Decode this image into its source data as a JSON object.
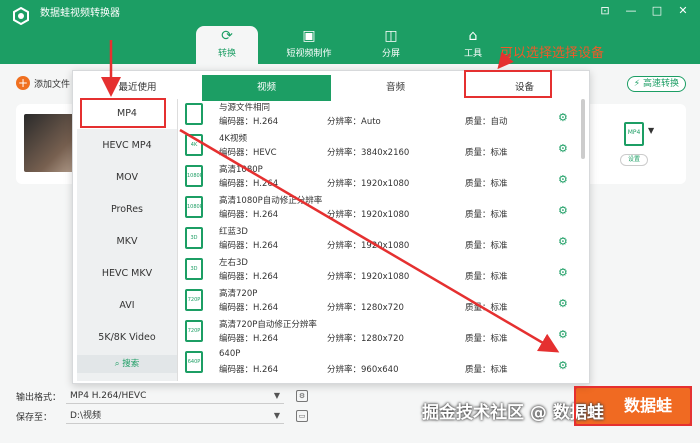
{
  "app": {
    "title": "数据蛙视频转换器",
    "window_controls": [
      "⊡",
      "—",
      "□",
      "✕"
    ]
  },
  "nav": {
    "tabs": [
      {
        "label": "转换",
        "icon": "convert-icon",
        "active": true
      },
      {
        "label": "短视频制作",
        "icon": "image-icon"
      },
      {
        "label": "分屏",
        "icon": "split-screen-icon"
      },
      {
        "label": "工具",
        "icon": "toolbox-icon"
      }
    ]
  },
  "toolbar": {
    "add_file": "添加文件",
    "fast_convert": "高速转换"
  },
  "popup": {
    "tabs": [
      {
        "label": "最近使用"
      },
      {
        "label": "视频",
        "active": true
      },
      {
        "label": "音频"
      },
      {
        "label": "设备"
      }
    ],
    "formats": [
      "MP4",
      "HEVC MP4",
      "MOV",
      "ProRes",
      "MKV",
      "HEVC MKV",
      "AVI",
      "5K/8K Video"
    ],
    "selected_format": "MP4",
    "search_label": "搜索",
    "presets": [
      {
        "name": "与源文件相同",
        "icon_text": "",
        "encoder": "编码器：H.264",
        "resolution": "分辨率：Auto",
        "quality": "质量：自动"
      },
      {
        "name": "4K视频",
        "icon_text": "4K",
        "encoder": "编码器：HEVC",
        "resolution": "分辨率：3840x2160",
        "quality": "质量：标准"
      },
      {
        "name": "高清1080P",
        "icon_text": "1080P",
        "encoder": "编码器：H.264",
        "resolution": "分辨率：1920x1080",
        "quality": "质量：标准"
      },
      {
        "name": "高清1080P自动修正分辨率",
        "icon_text": "1080P",
        "encoder": "编码器：H.264",
        "resolution": "分辨率：1920x1080",
        "quality": "质量：标准"
      },
      {
        "name": "红蓝3D",
        "icon_text": "3D",
        "encoder": "编码器：H.264",
        "resolution": "分辨率：1920x1080",
        "quality": "质量：标准"
      },
      {
        "name": "左右3D",
        "icon_text": "3D",
        "encoder": "编码器：H.264",
        "resolution": "分辨率：1920x1080",
        "quality": "质量：标准"
      },
      {
        "name": "高清720P",
        "icon_text": "720P",
        "encoder": "编码器：H.264",
        "resolution": "分辨率：1280x720",
        "quality": "质量：标准"
      },
      {
        "name": "高清720P自动修正分辨率",
        "icon_text": "720P",
        "encoder": "编码器：H.264",
        "resolution": "分辨率：1280x720",
        "quality": "质量：标准"
      },
      {
        "name": "640P",
        "icon_text": "640P",
        "encoder": "编码器：H.264",
        "resolution": "分辨率：960x640",
        "quality": "质量：标准"
      }
    ]
  },
  "file_item": {
    "output_format_icon": "MP4",
    "settings_label": "设置"
  },
  "bottom": {
    "output_format_label": "输出格式：",
    "output_format_value": "MP4 H.264/HEVC",
    "save_to_label": "保存至：",
    "save_to_value": "D:\\视频"
  },
  "convert_all": "数据蛙",
  "watermark": "掘金技术社区 @ 数据蛙",
  "annotation": "可以选择选择设备",
  "colors": {
    "brand": "#1c9e64",
    "accent": "#f06a22",
    "annotation_red": "#e53030"
  }
}
